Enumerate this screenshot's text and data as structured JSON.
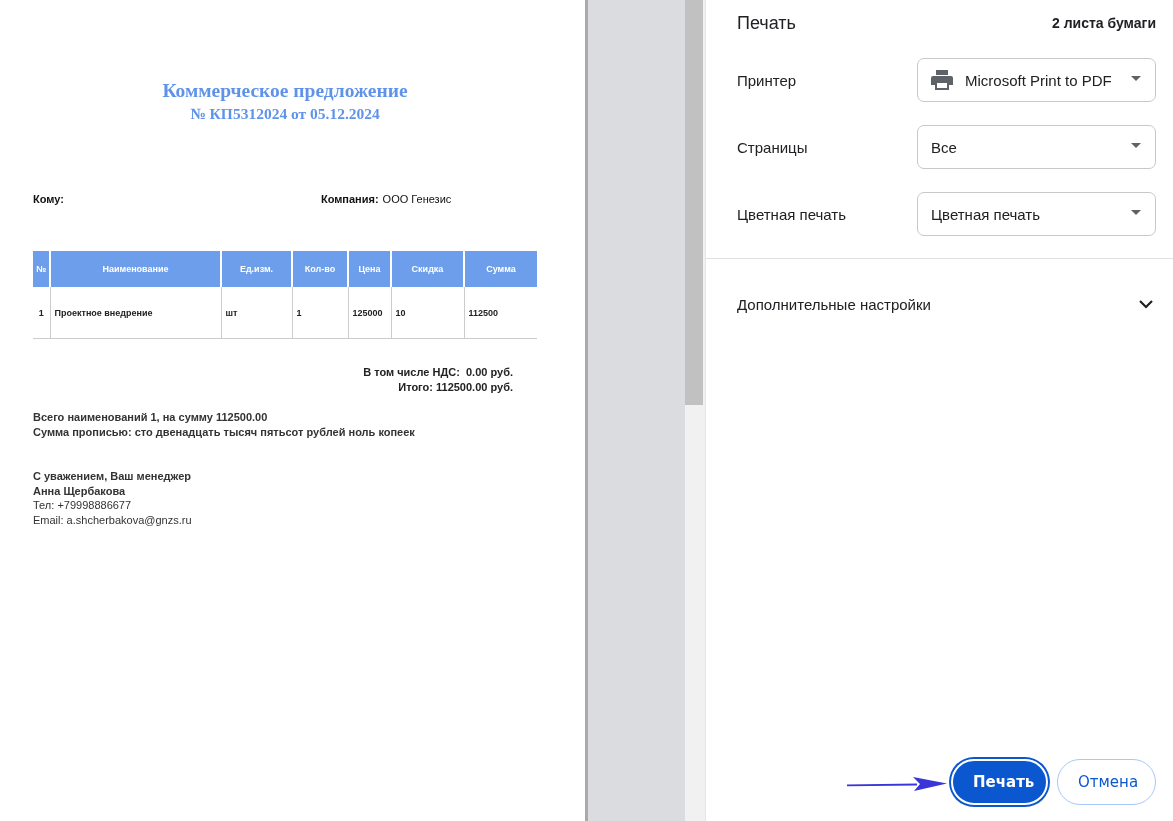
{
  "document": {
    "title": "Коммерческое предложение",
    "subtitle": "№ КП5312024 от 05.12.2024",
    "recipient_label": "Кому:",
    "company_label": "Компания:",
    "company_value": "ООО Генезис",
    "table": {
      "columns": [
        "№",
        "Наименование",
        "Ед.изм.",
        "Кол-во",
        "Цена",
        "Скидка",
        "Сумма"
      ],
      "rows": [
        [
          "1",
          "Проектное внедрение",
          "шт",
          "1",
          "125000",
          "10",
          "112500"
        ]
      ]
    },
    "totals": [
      "В том числе НДС:  **0.00 руб.**",
      "Итого: **112500.00** руб."
    ],
    "summary": [
      "Всего наименований 1, на сумму **112500.00**",
      "Сумма прописью: сто двенадцать тысяч пятьсот рублей ноль копеек"
    ],
    "signature": [
      {
        "text": "С уважением, Ваш менеджер",
        "bold": true
      },
      {
        "text": "Анна Щербакова",
        "bold": true
      },
      {
        "text": "Тел: +79998886677",
        "bold": false
      },
      {
        "text": "Email: a.shcherbakova@gnzs.ru",
        "bold": false
      }
    ]
  },
  "print_panel": {
    "title": "Печать",
    "sheets": "2 листа бумаги",
    "settings": [
      {
        "label": "Принтер",
        "value": "Microsoft Print to PDF",
        "kind": "printer"
      },
      {
        "label": "Страницы",
        "value": "Все",
        "kind": "plain"
      },
      {
        "label": "Цветная печать",
        "value": "Цветная печать",
        "kind": "plain"
      }
    ],
    "more_settings": {
      "label": "Дополнительные настройки",
      "expanded": false
    },
    "buttons": [
      {
        "label": "Печать",
        "kind": "primary"
      },
      {
        "label": "Отмена",
        "kind": "secondary"
      }
    ]
  }
}
